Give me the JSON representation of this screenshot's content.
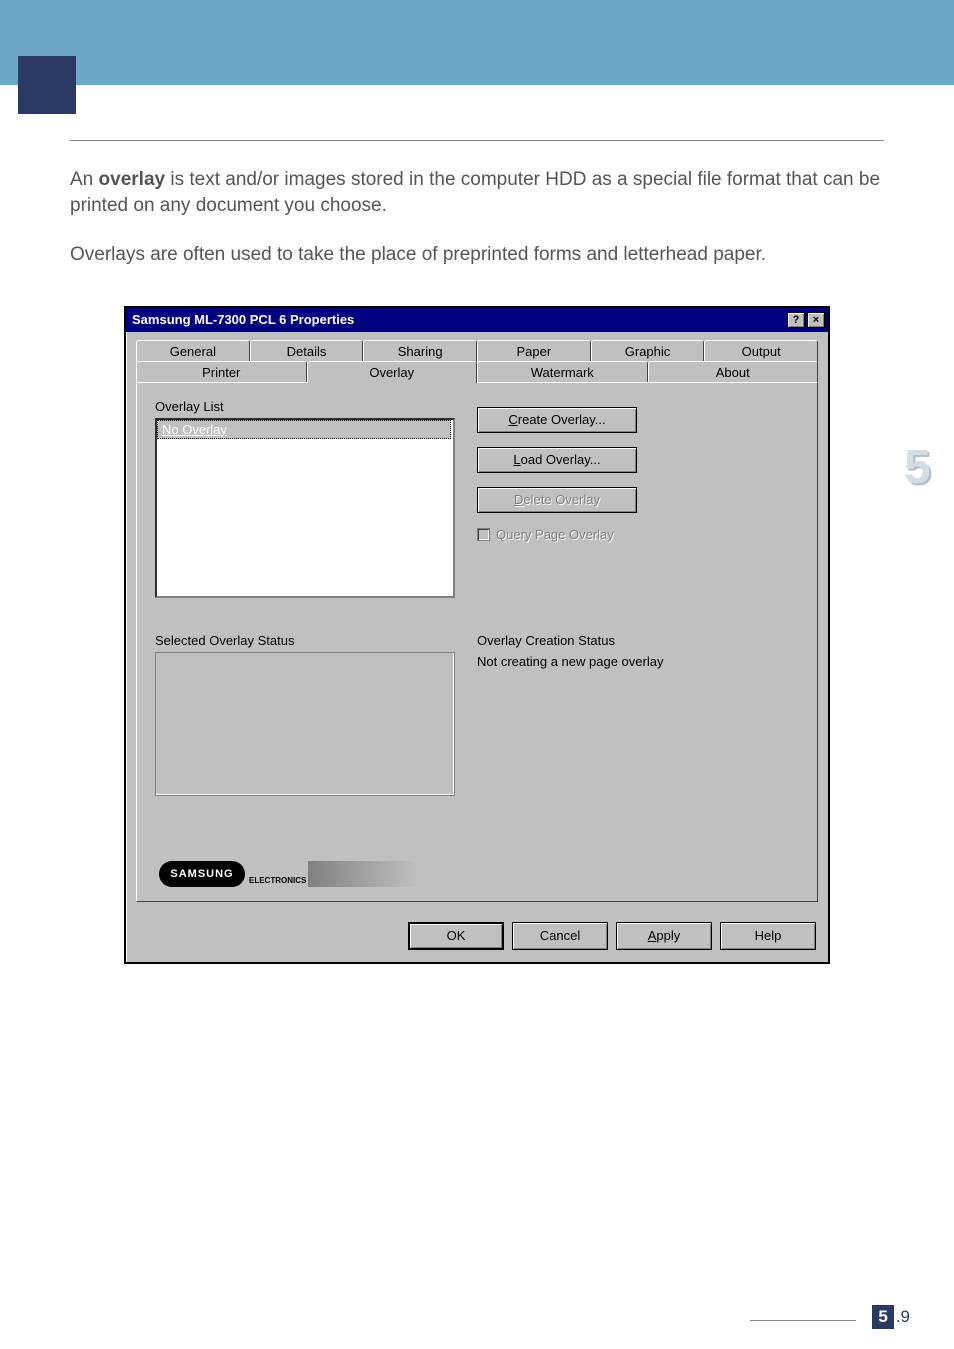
{
  "intro": {
    "p1a": "An ",
    "p1b": "overlay",
    "p1c": " is text and/or images stored in the computer HDD as a special file format that can be printed on any document you choose.",
    "p2": "Overlays are often used to take the place of preprinted forms and letterhead paper."
  },
  "dialog": {
    "title": "Samsung ML-7300 PCL 6 Properties",
    "help_glyph": "?",
    "close_glyph": "×",
    "tabs_row1": [
      "General",
      "Details",
      "Sharing",
      "Paper",
      "Graphic",
      "Output"
    ],
    "tabs_row2": [
      "Printer",
      "Overlay",
      "Watermark",
      "About"
    ],
    "overlay_list_label": "Overlay List",
    "overlay_list_item": "No Overlay",
    "create_btn_u": "C",
    "create_btn_rest": "reate Overlay...",
    "load_btn_u": "L",
    "load_btn_rest": "oad Overlay...",
    "delete_btn_u": "D",
    "delete_btn_rest": "elete Overlay",
    "query_chk_u": "Q",
    "query_chk_rest": "uery Page Overlay",
    "selected_status_label": "Selected Overlay Status",
    "creation_status_label": "Overlay Creation Status",
    "creation_status_value": "Not creating a new page overlay",
    "logo_text": "SAMSUNG",
    "logo_sub": "ELECTRONICS",
    "ok": "OK",
    "cancel": "Cancel",
    "apply_u": "A",
    "apply_rest": "pply",
    "help": "Help"
  },
  "side_number": "5",
  "footer": {
    "chapter": "5",
    "page": ".9"
  }
}
